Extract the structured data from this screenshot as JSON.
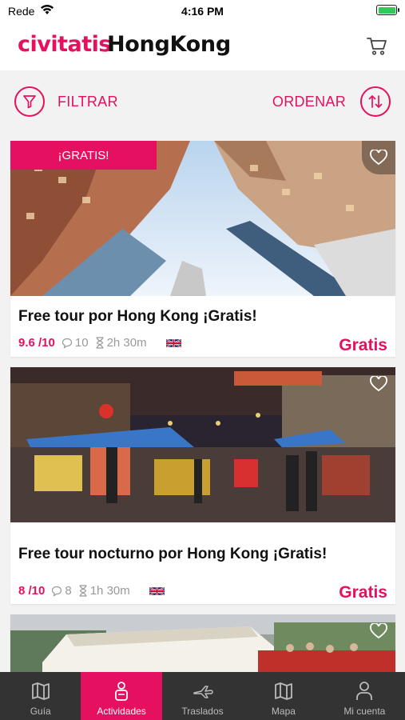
{
  "status_bar": {
    "carrier": "Rede",
    "time": "4:16 PM"
  },
  "header": {
    "brand": "civitatis",
    "city": "HongKong"
  },
  "filters": {
    "filter_label": "FILTRAR",
    "sort_label": "ORDENAR"
  },
  "colors": {
    "accent": "#e5105f",
    "tabbar": "#333333"
  },
  "cards": [
    {
      "badge": "¡GRATIS!",
      "title": "Free tour por Hong Kong ¡Gratis!",
      "rating": "9.6 /10",
      "reviews": "10",
      "duration": "2h 30m",
      "language_flag": "uk-flag-icon",
      "price": "Gratis"
    },
    {
      "title": "Free tour nocturno por Hong Kong ¡Gratis!",
      "rating": "8 /10",
      "reviews": "8",
      "duration": "1h 30m",
      "language_flag": "uk-flag-icon",
      "price": "Gratis"
    }
  ],
  "tabs": [
    {
      "label": "Guía",
      "icon": "map-guide-icon"
    },
    {
      "label": "Actividades",
      "icon": "activities-icon",
      "active": true
    },
    {
      "label": "Traslados",
      "icon": "plane-icon"
    },
    {
      "label": "Mapa",
      "icon": "map-icon"
    },
    {
      "label": "Mi cuenta",
      "icon": "user-icon"
    }
  ]
}
